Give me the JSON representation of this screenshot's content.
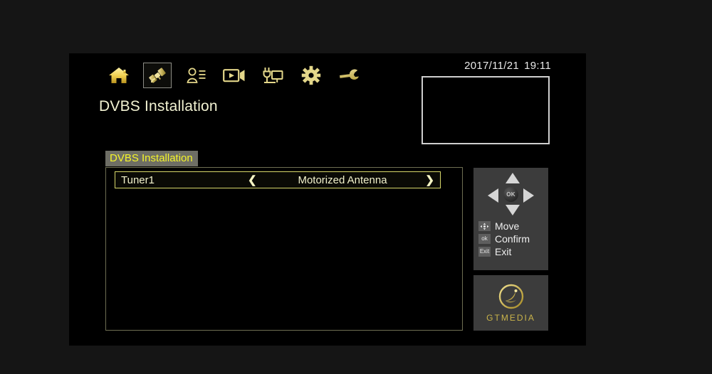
{
  "header": {
    "title": "DVBS Installation",
    "datetime": {
      "date": "2017/11/21",
      "time": "19:11"
    },
    "nav_icons": [
      {
        "name": "home-icon",
        "label": "Home",
        "selected": false
      },
      {
        "name": "satellite-icon",
        "label": "Installation",
        "selected": true
      },
      {
        "name": "user-settings-icon",
        "label": "User Settings",
        "selected": false
      },
      {
        "name": "media-player-icon",
        "label": "Media",
        "selected": false
      },
      {
        "name": "system-connect-icon",
        "label": "System",
        "selected": false
      },
      {
        "name": "gear-icon",
        "label": "Settings",
        "selected": false
      },
      {
        "name": "wrench-icon",
        "label": "Tools",
        "selected": false
      }
    ]
  },
  "preview": {
    "label": "Video Preview"
  },
  "tabs": [
    {
      "label": "DVBS Installation",
      "active": true
    }
  ],
  "list": {
    "rows": [
      {
        "label": "Tuner1",
        "value": "Motorized Antenna",
        "prev_arrow": "❮",
        "next_arrow": "❯",
        "selected": true
      }
    ]
  },
  "help_panel": {
    "dpad": {
      "ok_label": "OK"
    },
    "legend": [
      {
        "badge": "dpad-badge",
        "badge_text": "",
        "label": "Move"
      },
      {
        "badge": "ok-badge",
        "badge_text": "ok",
        "label": "Confirm"
      },
      {
        "badge": "exit-badge",
        "badge_text": "Exit",
        "label": "Exit"
      }
    ]
  },
  "brand": {
    "name": "GTMEDIA",
    "mark": "satellite-dish-logo"
  },
  "colors": {
    "screen_bg": "#000000",
    "outer_bg": "#151515",
    "accent_yellow": "#f5f52a",
    "text_cream": "#f3f3cd",
    "tab_bg": "#6e6e65",
    "panel_gray": "#3c3c3c",
    "border_olive": "#6e6e52",
    "row_border": "#d8d86a",
    "brand_gold": "#c9b34a"
  }
}
